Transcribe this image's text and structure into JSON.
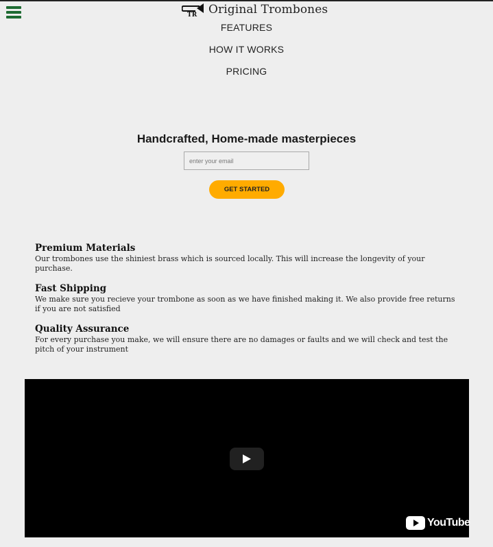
{
  "header": {
    "menu_icon": "hamburger-menu-icon",
    "logo_icon": "trombone-logo-icon",
    "brand": "Original Trombones",
    "accent_color": "#1e6b32"
  },
  "nav": {
    "items": [
      {
        "label": "FEATURES"
      },
      {
        "label": "HOW IT WORKS"
      },
      {
        "label": "PRICING"
      }
    ]
  },
  "hero": {
    "title": "Handcrafted, Home-made masterpieces",
    "email_placeholder": "enter your email",
    "email_value": "",
    "cta_label": "GET STARTED",
    "cta_color": "#ffab00"
  },
  "features": [
    {
      "title": "Premium Materials",
      "text": "Our trombones use the shiniest brass which is sourced locally. This will increase the longevity of your purchase."
    },
    {
      "title": "Fast Shipping",
      "text": "We make sure you recieve your trombone as soon as we have finished making it. We also provide free returns if you are not satisfied"
    },
    {
      "title": "Quality Assurance",
      "text": "For every purchase you make, we will ensure there are no damages or faults and we will check and test the pitch of your instrument"
    }
  ],
  "video": {
    "play_icon": "play-icon",
    "provider_label": "YouTube",
    "provider_icon": "youtube-logo-icon"
  }
}
